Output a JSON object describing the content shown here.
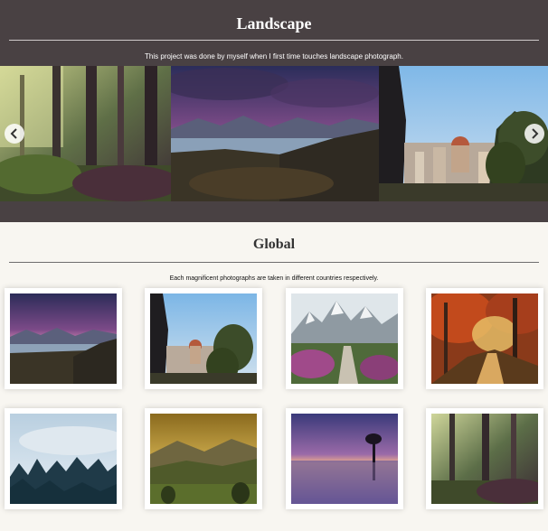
{
  "header": {
    "title": "Landscape",
    "subtitle": "This project was done by myself when I first time touches landscape photograph."
  },
  "carousel": {
    "slides": [
      {
        "icon": "forest-photo"
      },
      {
        "icon": "mountain-lake-sunset-photo"
      },
      {
        "icon": "florence-cityscape-photo"
      }
    ],
    "prev_icon": "chevron-left-icon",
    "next_icon": "chevron-right-icon"
  },
  "global": {
    "title": "Global",
    "subtitle": "Each magnificent photographs are taken in different countries respectively.",
    "photos": [
      {
        "icon": "mountain-lake-sunset-photo"
      },
      {
        "icon": "florence-cityscape-photo"
      },
      {
        "icon": "snowy-mountain-path-photo"
      },
      {
        "icon": "autumn-forest-photo"
      },
      {
        "icon": "misty-pine-forest-photo"
      },
      {
        "icon": "golden-valley-photo"
      },
      {
        "icon": "lone-tree-lake-photo"
      },
      {
        "icon": "green-forest-photo"
      }
    ]
  },
  "colors": {
    "header_bg": "#494143",
    "page_bg": "#f8f6f1",
    "title_text": "#ffffff"
  }
}
